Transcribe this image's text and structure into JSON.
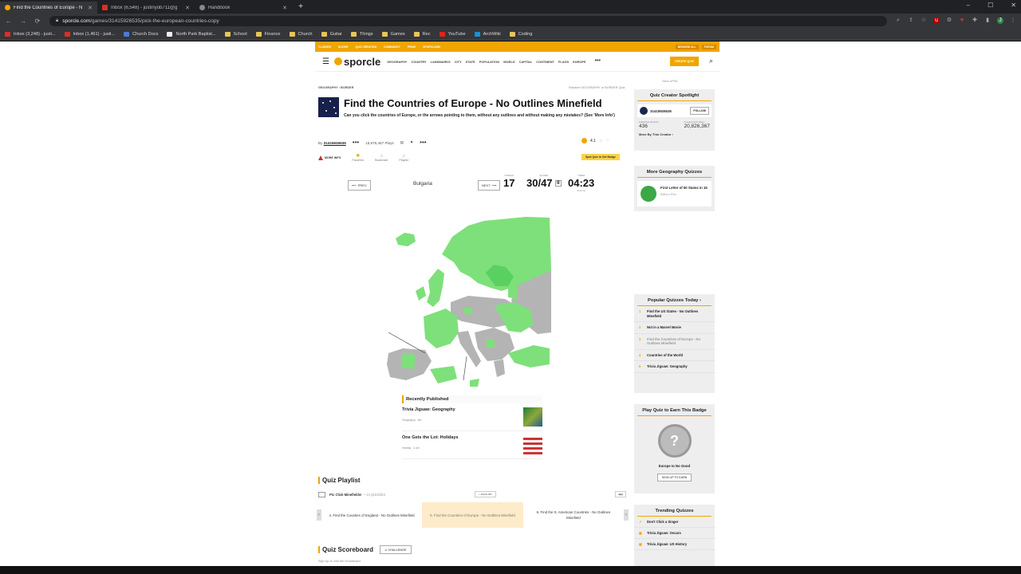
{
  "browser": {
    "tabs": [
      {
        "label": "Find the Countries of Europe - N",
        "active": true,
        "icon_color": "#f0a500"
      },
      {
        "label": "Inbox (6,548) - justinyob711@g",
        "active": false,
        "icon_color": "#d93025"
      },
      {
        "label": "Handbook",
        "active": false,
        "icon_color": "#bbbbbb"
      }
    ],
    "url_host": "sporcle.com",
    "url_path": "/games/31415926535/pick-the-european-countries-copy",
    "bookmarks": [
      {
        "label": "Inbox (3,248) - justi...",
        "icon": "gmail-icon"
      },
      {
        "label": "Inbox (1,461) - justi...",
        "icon": "gmail-icon"
      },
      {
        "label": "Church Docs",
        "icon": "doc-icon"
      },
      {
        "label": "North Park Baptist...",
        "icon": "site-icon"
      },
      {
        "label": "School",
        "icon": "folder-icon"
      },
      {
        "label": "Finance",
        "icon": "folder-icon"
      },
      {
        "label": "Church",
        "icon": "folder-icon"
      },
      {
        "label": "Guitar",
        "icon": "folder-icon"
      },
      {
        "label": "Things",
        "icon": "folder-icon"
      },
      {
        "label": "Games",
        "icon": "folder-icon"
      },
      {
        "label": "Rec",
        "icon": "folder-icon"
      },
      {
        "label": "YouTube",
        "icon": "youtube-icon"
      },
      {
        "label": "ArchWiki",
        "icon": "arch-icon"
      },
      {
        "label": "Coding",
        "icon": "folder-icon"
      }
    ]
  },
  "promo": {
    "items": [
      "CLASSES",
      "SLIDER",
      "QUIZ CREATION",
      "COMMUNITY",
      "PRIDE",
      "SPORCLE360"
    ],
    "right": [
      "BROWSE ALL",
      "FORUM"
    ]
  },
  "header": {
    "logo": "sporcle",
    "nav": [
      "GEOGRAPHY",
      "COUNTRY",
      "LANDMARKS",
      "CITY",
      "STATE",
      "POPULATION",
      "WORLD",
      "CAPITAL",
      "CONTINENT",
      "FLAGS",
      "EUROPE"
    ],
    "more": "•••",
    "create": "CREATE QUIZ"
  },
  "quiz": {
    "breadcrumb": "GEOGRAPHY  ›  BORDER",
    "breadcrumb_right": "Random GEOGRAPHY or BORDER Quiz",
    "title": "Find the Countries of Europe - No Outlines Minefield",
    "description": "Can you click the countries of Europe, or the arrows pointing to them, without any outlines and without making any mistakes? (See 'More Info')",
    "by": "By",
    "author": "31415926535",
    "plays": "15,875,457 Plays",
    "rating": "4.1",
    "more_info": "MORE INFO",
    "actions": [
      "Favorites",
      "Bookmark",
      "Playlist"
    ],
    "badge_chip": "Spot Quiz to Get Badge",
    "prev": "PREV",
    "next": "NEXT",
    "current_country": "Bulgaria",
    "stats": {
      "streak_label": "STREAK",
      "streak": "17",
      "score_label": "SCORE",
      "score": "30/47",
      "timer_label": "TIMER",
      "timer": "04:23",
      "timer_sub": "Give Up"
    }
  },
  "recently_published": {
    "heading": "Recently Published",
    "items": [
      {
        "title": "Trivia Jigsaw: Geography",
        "category": "Geography",
        "meta": "5m"
      },
      {
        "title": "One Gets the Lot: Holidays",
        "category": "Holiday",
        "meta": "4.4m"
      }
    ]
  },
  "playlist": {
    "heading": "Quiz Playlist",
    "name": "Pic Click Minefields!",
    "count": "14 QUIZZES",
    "options_label": "PLAYLIST",
    "cards": [
      {
        "label": "4. Find the Counties of England - No Outlines Minefield"
      },
      {
        "label": "5. Find the Countries of Europe - No Outlines Minefield"
      },
      {
        "label": "6. Find the S. American Countries - No Outlines Minefield"
      }
    ]
  },
  "scoreboard": {
    "heading": "Quiz Scoreboard",
    "challenge": "CHALLENGE",
    "signup": "Sign Up to Join the Scoreboard"
  },
  "sidebar": {
    "ad_label": "Sales APRIL",
    "spotlight": {
      "heading": "Quiz Creator Spotlight",
      "name": "31415926535",
      "follow": "FOLLOW",
      "stat1_label": "Published Quizzes",
      "stat1": "436",
      "stat2_label": "Created Quiz Plays",
      "stat2": "20,826,367",
      "more": "More By This Creator ›"
    },
    "geo": {
      "heading": "More Geography Quizzes",
      "title": "First Letter of 50 States in 15",
      "sub": "Editor's Pick"
    },
    "popular": {
      "heading": "Popular Quizzes Today ›",
      "items": [
        "Find the US States - No Outlines Minefield",
        "Not in a Marvel Movie",
        "Find the Countries of Europe - No Outlines Minefield",
        "Countries of the World",
        "Trivia Jigsaw: Geography"
      ]
    },
    "badge": {
      "heading": "Play Quiz to Earn This Badge",
      "name": "Europe to No Good",
      "signup": "SIGN UP TO EARN"
    },
    "trending": {
      "heading": "Trending Quizzes",
      "items": [
        "Don't Click a Singer",
        "Trivia Jigsaw: Oscars",
        "Trivia Jigsaw: US History"
      ]
    }
  },
  "colors": {
    "accent": "#f0a500",
    "found": "#7ee07a",
    "unfound": "#b4b4b4"
  }
}
